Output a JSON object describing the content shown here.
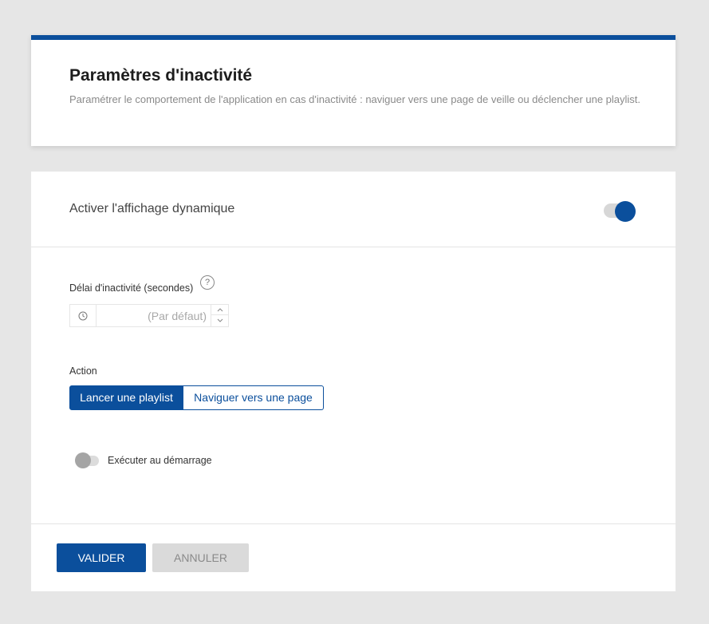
{
  "header": {
    "title": "Paramètres d'inactivité",
    "description": "Paramétrer le comportement de l'application en cas d'inactivité : naviguer vers une page de veille ou déclencher une playlist."
  },
  "dynamic_display": {
    "label": "Activer l'affichage dynamique",
    "enabled": true
  },
  "delay": {
    "label": "Délai d'inactivité (secondes)",
    "help_icon": "question-circle-icon",
    "help_glyph": "?",
    "value": "",
    "placeholder": "(Par défaut)",
    "prefix_icon": "clock-icon"
  },
  "action": {
    "label": "Action",
    "options": [
      {
        "label": "Lancer une playlist",
        "selected": true
      },
      {
        "label": "Naviguer vers une page",
        "selected": false
      }
    ]
  },
  "startup": {
    "label": "Exécuter au démarrage",
    "enabled": false
  },
  "footer": {
    "validate_label": "VALIDER",
    "cancel_label": "ANNULER"
  },
  "colors": {
    "accent": "#0b4f9c",
    "background": "#e6e6e6",
    "toggle_off": "#a5a5a5"
  }
}
